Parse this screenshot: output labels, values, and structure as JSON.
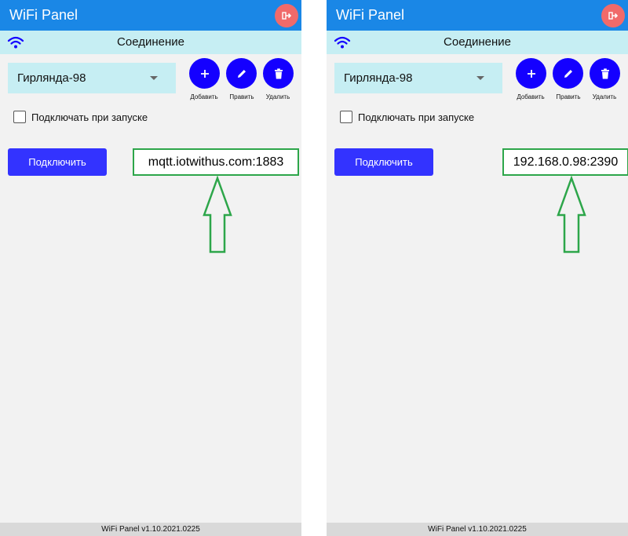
{
  "app": {
    "title": "WiFi Panel",
    "exit_icon": "logout-icon",
    "accent": "#1a87e6",
    "exit_color": "#f06a6a"
  },
  "connection": {
    "header": "Соединение",
    "wifi_icon": "wifi-icon",
    "selected_profile": "Гирлянда-98",
    "add_label": "Добавить",
    "edit_label": "Править",
    "delete_label": "Удалить",
    "autoconnect_label": "Подключать при запуске",
    "autoconnect_checked": false,
    "connect_label": "Подключить"
  },
  "panels": [
    {
      "address": "mqtt.iotwithus.com:1883"
    },
    {
      "address": "192.168.0.98:2390"
    }
  ],
  "footer": {
    "version": "WiFi Panel v1.10.2021.0225"
  },
  "colors": {
    "subbar": "#c6eef3",
    "fab": "#1400ff",
    "connect": "#3333ff",
    "highlight": "#2da64a"
  }
}
